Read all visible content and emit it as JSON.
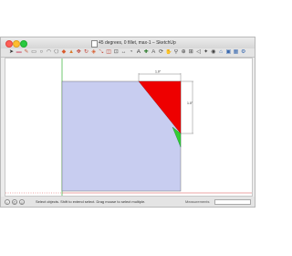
{
  "window": {
    "title": "45 degrees, 0 fillet, max-1 – SketchUp"
  },
  "toolbar": {
    "tools": [
      {
        "icon": "select-arrow-icon",
        "glyph": "➤",
        "color": "#333333"
      },
      {
        "icon": "eraser-icon",
        "glyph": "▬",
        "color": "#d88a9a"
      },
      {
        "icon": "pencil-icon",
        "glyph": "✎",
        "color": "#c85a3c"
      },
      {
        "icon": "rectangle-icon",
        "glyph": "▭",
        "color": "#555555"
      },
      {
        "icon": "circle-icon",
        "glyph": "○",
        "color": "#555555"
      },
      {
        "icon": "arc-icon",
        "glyph": "◠",
        "color": "#555555"
      },
      {
        "icon": "polygon-icon",
        "glyph": "⬠",
        "color": "#555555"
      },
      {
        "icon": "paint-bucket-icon",
        "glyph": "◆",
        "color": "#d85a2a"
      },
      {
        "icon": "push-pull-icon",
        "glyph": "▲",
        "color": "#d87a2a"
      },
      {
        "icon": "move-icon",
        "glyph": "✥",
        "color": "#c0392b"
      },
      {
        "icon": "rotate-icon",
        "glyph": "↻",
        "color": "#c0392b"
      },
      {
        "icon": "follow-me-icon",
        "glyph": "◈",
        "color": "#d85a2a"
      },
      {
        "icon": "scale-icon",
        "glyph": "⤡",
        "color": "#c0392b"
      },
      {
        "icon": "offset-icon",
        "glyph": "◫",
        "color": "#c0392b"
      },
      {
        "icon": "tape-measure-icon",
        "glyph": "⊡",
        "color": "#555555"
      },
      {
        "icon": "dimension-icon",
        "glyph": "↔",
        "color": "#555555"
      },
      {
        "icon": "protractor-icon",
        "glyph": "◔",
        "color": "#555555"
      },
      {
        "icon": "text-icon",
        "glyph": "A",
        "color": "#333333"
      },
      {
        "icon": "axes-icon",
        "glyph": "✚",
        "color": "#2a7a2a"
      },
      {
        "icon": "3d-text-icon",
        "glyph": "A",
        "color": "#555555"
      },
      {
        "icon": "orbit-icon",
        "glyph": "⟳",
        "color": "#444444"
      },
      {
        "icon": "pan-icon",
        "glyph": "✋",
        "color": "#444444"
      },
      {
        "icon": "zoom-icon",
        "glyph": "⚲",
        "color": "#444444"
      },
      {
        "icon": "zoom-window-icon",
        "glyph": "⊕",
        "color": "#444444"
      },
      {
        "icon": "zoom-extents-icon",
        "glyph": "⊞",
        "color": "#444444"
      },
      {
        "icon": "previous-view-icon",
        "glyph": "◁",
        "color": "#444444"
      },
      {
        "icon": "walk-icon",
        "glyph": "✦",
        "color": "#444444"
      },
      {
        "icon": "look-around-icon",
        "glyph": "◉",
        "color": "#444444"
      },
      {
        "icon": "warehouse-icon",
        "glyph": "⌂",
        "color": "#3a6ab0"
      },
      {
        "icon": "share-model-icon",
        "glyph": "▣",
        "color": "#3a6ab0"
      },
      {
        "icon": "components-icon",
        "glyph": "▦",
        "color": "#3a6ab0"
      },
      {
        "icon": "extension-warehouse-icon",
        "glyph": "⚙",
        "color": "#3a6ab0"
      }
    ]
  },
  "model": {
    "face_color": "#c8cdf0",
    "red_color": "#ee0000",
    "green_color": "#33cc33",
    "dimension_horizontal": "1.0\"",
    "dimension_vertical": "1.0\""
  },
  "status": {
    "icons": [
      "info-icon",
      "credit-icon",
      "user-icon"
    ],
    "icon_glyphs": [
      "i",
      "©",
      "☺"
    ],
    "message": "Select objects. Shift to extend select. Drag mouse to select multiple.",
    "measurements_label": "Measurements",
    "measurements_value": ""
  }
}
